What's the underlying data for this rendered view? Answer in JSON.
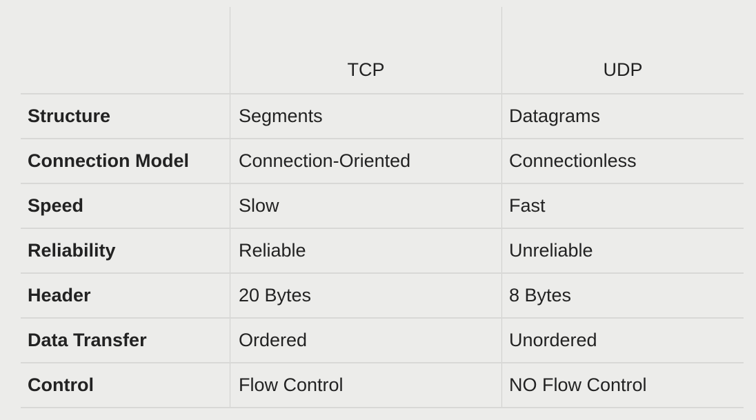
{
  "table": {
    "headers": [
      "",
      "TCP",
      "UDP"
    ],
    "rows": [
      [
        "Structure",
        "Segments",
        "Datagrams"
      ],
      [
        "Connection Model",
        "Connection-Oriented",
        "Connectionless"
      ],
      [
        "Speed",
        "Slow",
        "Fast"
      ],
      [
        "Reliability",
        "Reliable",
        "Unreliable"
      ],
      [
        "Header",
        "20 Bytes",
        "8 Bytes"
      ],
      [
        "Data Transfer",
        "Ordered",
        "Unordered"
      ],
      [
        "Control",
        "Flow Control",
        "NO Flow Control"
      ]
    ]
  }
}
